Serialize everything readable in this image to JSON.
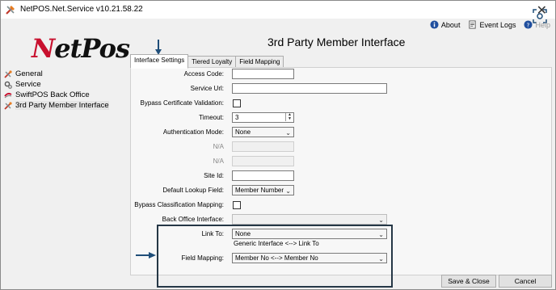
{
  "window": {
    "title": "NetPOS.Net.Service v10.21.58.22"
  },
  "toplinks": {
    "about": "About",
    "event_logs": "Event Logs",
    "help": "Help"
  },
  "logo": {
    "letter_n": "N",
    "rest": "etPos"
  },
  "nav": {
    "items": [
      {
        "label": "General",
        "icon": "wrench-screwdriver-icon"
      },
      {
        "label": "Service",
        "icon": "gears-icon"
      },
      {
        "label": "SwiftPOS Back Office",
        "icon": "swiftpos-icon"
      },
      {
        "label": "3rd Party Member Interface",
        "icon": "wrench-screwdriver-icon"
      }
    ]
  },
  "page_title": "3rd Party Member Interface",
  "tabs": [
    "Interface Settings",
    "Tiered Loyalty",
    "Field Mapping"
  ],
  "form": {
    "access_code_label": "Access Code:",
    "access_code_value": "",
    "service_url_label": "Service Url:",
    "service_url_value": "",
    "bypass_cert_label": "Bypass Certificate Validation:",
    "timeout_label": "Timeout:",
    "timeout_value": "3",
    "auth_mode_label": "Authentication Mode:",
    "auth_mode_value": "None",
    "na1_label": "N/A",
    "na2_label": "N/A",
    "site_id_label": "Site Id:",
    "site_id_value": "",
    "default_lookup_label": "Default Lookup Field:",
    "default_lookup_value": "Member Number",
    "bypass_class_label": "Bypass Classification Mapping:",
    "back_office_label": "Back Office Interface:",
    "back_office_value": "",
    "link_to_label": "Link To:",
    "link_to_value": "None",
    "generic_text": "Generic Interface <--> Link To",
    "field_mapping_label": "Field Mapping:",
    "field_mapping_value": "Member No <--> Member No"
  },
  "buttons": {
    "save_close": "Save & Close",
    "cancel": "Cancel"
  },
  "colors": {
    "logo_red": "#c8102e",
    "highlight": "#253746",
    "arrow": "#1f4e79"
  }
}
